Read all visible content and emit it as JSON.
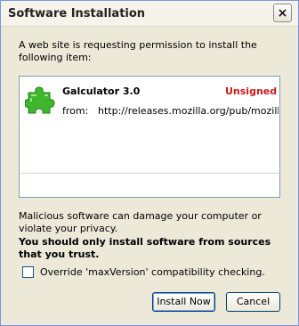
{
  "window": {
    "title": "Software Installation",
    "close_glyph": "×"
  },
  "intro_text": "A web site is requesting permission to install the following item:",
  "item": {
    "icon": "puzzle-piece-icon",
    "name": "Galculator 3.0",
    "status": "Unsigned",
    "status_color": "#cc1a1a",
    "from_label": "from:",
    "from_url": "http://releases.mozilla.org/pub/mozilla.org"
  },
  "warning_text": "Malicious software can damage your computer or violate your privacy.",
  "warning_bold_text": "You should only install software from sources that you trust.",
  "override_checkbox": {
    "label": "Override 'maxVersion' compatibility checking.",
    "checked": false
  },
  "buttons": {
    "install": "Install Now",
    "cancel": "Cancel"
  }
}
